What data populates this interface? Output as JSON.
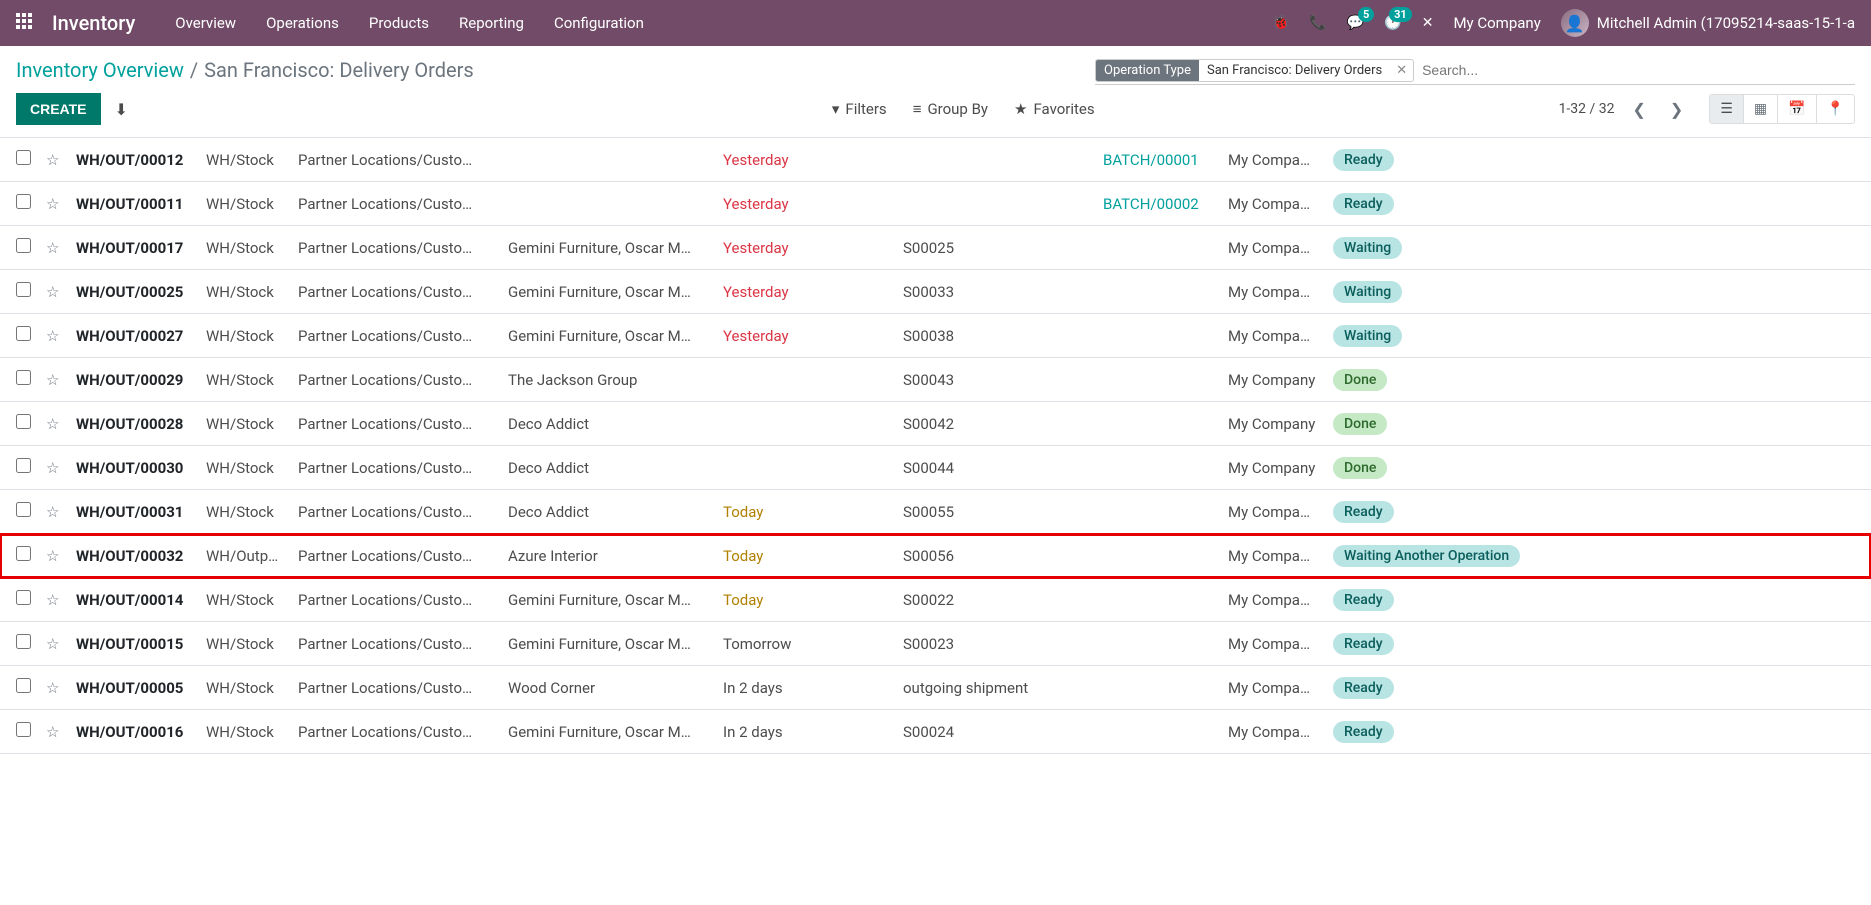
{
  "topbar": {
    "brand": "Inventory",
    "menu": [
      "Overview",
      "Operations",
      "Products",
      "Reporting",
      "Configuration"
    ],
    "msg_badge": "5",
    "activity_badge": "31",
    "company": "My Company",
    "user": "Mitchell Admin (17095214-saas-15-1-a"
  },
  "breadcrumb": {
    "root": "Inventory Overview",
    "current": "San Francisco: Delivery Orders"
  },
  "search": {
    "tag_key": "Operation Type",
    "tag_val": "San Francisco: Delivery Orders",
    "placeholder": "Search..."
  },
  "actions": {
    "create": "CREATE",
    "filters": "Filters",
    "groupby": "Group By",
    "favorites": "Favorites",
    "pager": "1-32 / 32"
  },
  "rows": [
    {
      "ref": "WH/OUT/00012",
      "from": "WH/Stock",
      "to": "Partner Locations/Custo…",
      "contact": "",
      "date": "Yesterday",
      "dateClass": "red",
      "source": "",
      "batch": "BATCH/00001",
      "company": "My Compa…",
      "status": "Ready",
      "statusClass": "status-ready",
      "hl": false
    },
    {
      "ref": "WH/OUT/00011",
      "from": "WH/Stock",
      "to": "Partner Locations/Custo…",
      "contact": "",
      "date": "Yesterday",
      "dateClass": "red",
      "source": "",
      "batch": "BATCH/00002",
      "company": "My Compa…",
      "status": "Ready",
      "statusClass": "status-ready",
      "hl": false
    },
    {
      "ref": "WH/OUT/00017",
      "from": "WH/Stock",
      "to": "Partner Locations/Custo…",
      "contact": "Gemini Furniture, Oscar M…",
      "date": "Yesterday",
      "dateClass": "red",
      "source": "S00025",
      "batch": "",
      "company": "My Compa…",
      "status": "Waiting",
      "statusClass": "status-waiting",
      "hl": false
    },
    {
      "ref": "WH/OUT/00025",
      "from": "WH/Stock",
      "to": "Partner Locations/Custo…",
      "contact": "Gemini Furniture, Oscar M…",
      "date": "Yesterday",
      "dateClass": "red",
      "source": "S00033",
      "batch": "",
      "company": "My Compa…",
      "status": "Waiting",
      "statusClass": "status-waiting",
      "hl": false
    },
    {
      "ref": "WH/OUT/00027",
      "from": "WH/Stock",
      "to": "Partner Locations/Custo…",
      "contact": "Gemini Furniture, Oscar M…",
      "date": "Yesterday",
      "dateClass": "red",
      "source": "S00038",
      "batch": "",
      "company": "My Compa…",
      "status": "Waiting",
      "statusClass": "status-waiting",
      "hl": false
    },
    {
      "ref": "WH/OUT/00029",
      "from": "WH/Stock",
      "to": "Partner Locations/Custo…",
      "contact": "The Jackson Group",
      "date": "",
      "dateClass": "",
      "source": "S00043",
      "batch": "",
      "company": "My Company",
      "status": "Done",
      "statusClass": "status-done",
      "hl": false
    },
    {
      "ref": "WH/OUT/00028",
      "from": "WH/Stock",
      "to": "Partner Locations/Custo…",
      "contact": "Deco Addict",
      "date": "",
      "dateClass": "",
      "source": "S00042",
      "batch": "",
      "company": "My Company",
      "status": "Done",
      "statusClass": "status-done",
      "hl": false
    },
    {
      "ref": "WH/OUT/00030",
      "from": "WH/Stock",
      "to": "Partner Locations/Custo…",
      "contact": "Deco Addict",
      "date": "",
      "dateClass": "",
      "source": "S00044",
      "batch": "",
      "company": "My Company",
      "status": "Done",
      "statusClass": "status-done",
      "hl": false
    },
    {
      "ref": "WH/OUT/00031",
      "from": "WH/Stock",
      "to": "Partner Locations/Custo…",
      "contact": "Deco Addict",
      "date": "Today",
      "dateClass": "yellow",
      "source": "S00055",
      "batch": "",
      "company": "My Compa…",
      "status": "Ready",
      "statusClass": "status-ready",
      "hl": false
    },
    {
      "ref": "WH/OUT/00032",
      "from": "WH/Outp…",
      "to": "Partner Locations/Custo…",
      "contact": "Azure Interior",
      "date": "Today",
      "dateClass": "yellow",
      "source": "S00056",
      "batch": "",
      "company": "My Compa…",
      "status": "Waiting Another Operation",
      "statusClass": "status-waiting",
      "hl": true
    },
    {
      "ref": "WH/OUT/00014",
      "from": "WH/Stock",
      "to": "Partner Locations/Custo…",
      "contact": "Gemini Furniture, Oscar M…",
      "date": "Today",
      "dateClass": "yellow",
      "source": "S00022",
      "batch": "",
      "company": "My Compa…",
      "status": "Ready",
      "statusClass": "status-ready",
      "hl": false
    },
    {
      "ref": "WH/OUT/00015",
      "from": "WH/Stock",
      "to": "Partner Locations/Custo…",
      "contact": "Gemini Furniture, Oscar M…",
      "date": "Tomorrow",
      "dateClass": "",
      "source": "S00023",
      "batch": "",
      "company": "My Compa…",
      "status": "Ready",
      "statusClass": "status-ready",
      "hl": false
    },
    {
      "ref": "WH/OUT/00005",
      "from": "WH/Stock",
      "to": "Partner Locations/Custo…",
      "contact": "Wood Corner",
      "date": "In 2 days",
      "dateClass": "",
      "source": "outgoing shipment",
      "batch": "",
      "company": "My Compa…",
      "status": "Ready",
      "statusClass": "status-ready",
      "hl": false
    },
    {
      "ref": "WH/OUT/00016",
      "from": "WH/Stock",
      "to": "Partner Locations/Custo…",
      "contact": "Gemini Furniture, Oscar M…",
      "date": "In 2 days",
      "dateClass": "",
      "source": "S00024",
      "batch": "",
      "company": "My Compa…",
      "status": "Ready",
      "statusClass": "status-ready",
      "hl": false
    }
  ]
}
